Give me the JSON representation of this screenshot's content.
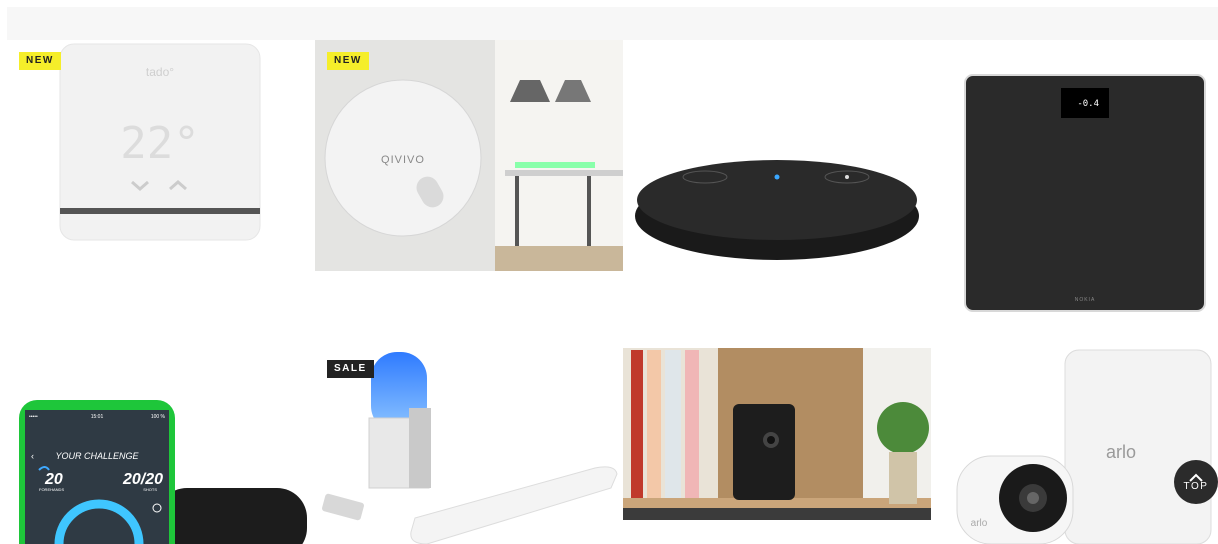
{
  "products": [
    {
      "badge": "NEW",
      "device": "tado° smart AC control",
      "display": "22°"
    },
    {
      "badge": "NEW",
      "device": "Qivivo smart thermostat",
      "brand": "QIVIVO"
    },
    {
      "badge": "",
      "device": "Echo Input smart speaker"
    },
    {
      "badge": "",
      "device": "Nokia Body scale",
      "brand": "NOKIA",
      "display": "-0.4"
    },
    {
      "badge": "",
      "device": "Tennis sensor app",
      "app": {
        "title": "YOUR CHALLENGE",
        "left": "20",
        "left_label": "FOREHANDS",
        "right": "20/20",
        "right_label": "SHOTS",
        "time": "15:01",
        "battery": "100 %"
      }
    },
    {
      "badge": "SALE",
      "device": "Withings Aura sleep system"
    },
    {
      "badge": "",
      "device": "Somfy One security camera"
    },
    {
      "badge": "",
      "device": "Arlo Ultra camera",
      "brand": "arlo"
    }
  ],
  "top_button": {
    "label": "TOP"
  }
}
